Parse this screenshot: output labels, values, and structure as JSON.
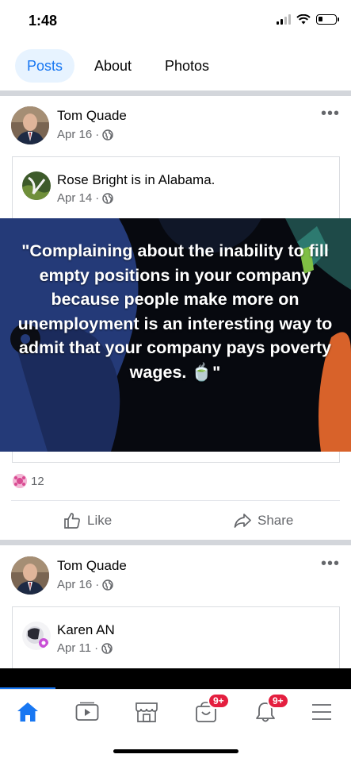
{
  "status_bar": {
    "time": "1:48"
  },
  "tabs": [
    {
      "label": "Posts",
      "active": true
    },
    {
      "label": "About",
      "active": false
    },
    {
      "label": "Photos",
      "active": false
    }
  ],
  "post1": {
    "author": "Tom Quade",
    "date": "Apr 16",
    "separator": "·",
    "more": "•••",
    "shared": {
      "name": "Rose Bright",
      "location_text": " is in ",
      "location": "Alabama.",
      "date": "Apr 14",
      "separator": "·",
      "image_text": "\"Complaining about the inability to fill empty positions in your company because people make more on unemployment is an interesting way to admit that your company pays poverty wages. 🍵\""
    },
    "reaction_count": "12",
    "like_label": "Like",
    "share_label": "Share"
  },
  "post2": {
    "author": "Tom Quade",
    "date": "Apr 16",
    "separator": "·",
    "more": "•••",
    "shared": {
      "name": "Karen AN",
      "date": "Apr 11",
      "separator": "·"
    }
  },
  "bottom_nav": {
    "items": [
      {
        "icon": "home-icon",
        "active": true
      },
      {
        "icon": "video-icon",
        "active": false
      },
      {
        "icon": "marketplace-icon",
        "active": false
      },
      {
        "icon": "groups-icon",
        "active": false,
        "badge": "9+"
      },
      {
        "icon": "bell-icon",
        "active": false,
        "badge": "9+"
      },
      {
        "icon": "menu-icon",
        "active": false
      }
    ]
  },
  "colors": {
    "accent": "#1877f2",
    "badge": "#e41e3f",
    "muted": "#65676b"
  }
}
